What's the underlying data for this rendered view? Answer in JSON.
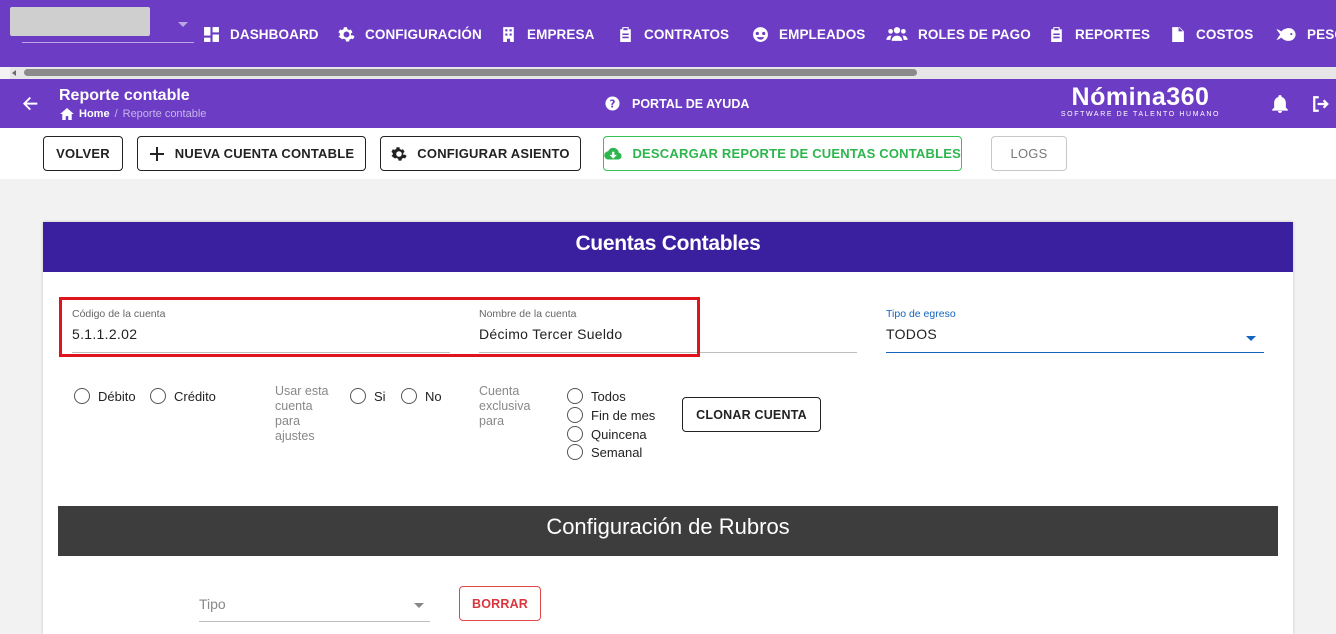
{
  "nav": {
    "items": [
      {
        "label": "DASHBOARD",
        "icon": "dashboard-icon"
      },
      {
        "label": "CONFIGURACIÓN",
        "icon": "gear-icon"
      },
      {
        "label": "EMPRESA",
        "icon": "building-icon"
      },
      {
        "label": "CONTRATOS",
        "icon": "clipboard-icon"
      },
      {
        "label": "EMPLEADOS",
        "icon": "globe-icon"
      },
      {
        "label": "ROLES DE PAGO",
        "icon": "users-icon"
      },
      {
        "label": "REPORTES",
        "icon": "clipboard-list-icon"
      },
      {
        "label": "COSTOS",
        "icon": "file-dollar-icon"
      },
      {
        "label": "PESC",
        "icon": "fish-icon"
      }
    ]
  },
  "header": {
    "title": "Reporte contable",
    "breadcrumb_home": "Home",
    "breadcrumb_sep": "/",
    "breadcrumb_current": "Reporte contable",
    "help_label": "PORTAL DE AYUDA",
    "brand_name": "Nómina360",
    "brand_tagline": "SOFTWARE DE TALENTO HUMANO"
  },
  "toolbar": {
    "volver": "VOLVER",
    "nueva": "NUEVA CUENTA CONTABLE",
    "configurar": "CONFIGURAR ASIENTO",
    "descargar": "DESCARGAR REPORTE DE CUENTAS CONTABLES",
    "logs": "LOGS"
  },
  "card": {
    "title": "Cuentas Contables",
    "codigo_label": "Código de la cuenta",
    "codigo_value": "5.1.1.2.02",
    "nombre_label": "Nombre de la cuenta",
    "nombre_value": "Décimo Tercer Sueldo",
    "tipo_egreso_label": "Tipo de egreso",
    "tipo_egreso_value": "TODOS",
    "debito": "Débito",
    "credito": "Crédito",
    "ajustes_label": "Usar esta cuenta para ajustes",
    "si": "Si",
    "no": "No",
    "exclusiva_label": "Cuenta exclusiva para",
    "exclusiva_options": [
      "Todos",
      "Fin de mes",
      "Quincena",
      "Semanal"
    ],
    "clonar": "CLONAR CUENTA"
  },
  "rubros": {
    "title": "Configuración de Rubros",
    "tipo_placeholder": "Tipo",
    "borrar": "BORRAR"
  },
  "colors": {
    "nav_bg": "#6c3cc4",
    "card_header": "#3a1f9e",
    "rubros_header": "#3d3d3d",
    "highlight": "#e0141c",
    "green": "#2db64d",
    "accent_blue": "#1565c0"
  }
}
